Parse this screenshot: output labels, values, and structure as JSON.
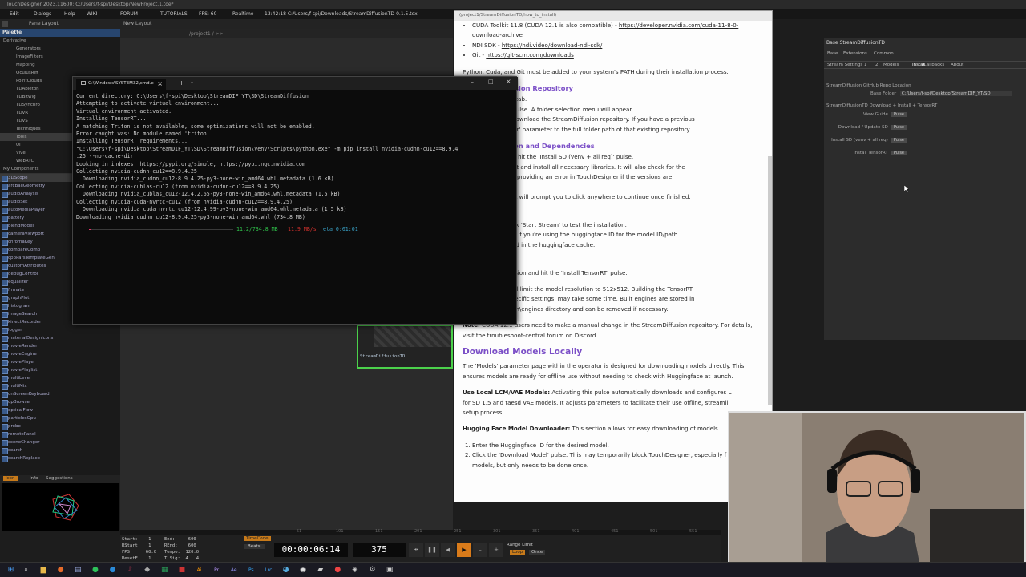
{
  "titlebar": "TouchDesigner 2023.11600: C:/Users/f-spi/Desktop/NewProject.1.toe*",
  "menu": [
    "Edit",
    "Dialogs",
    "Help",
    "WIKI",
    "FORUM",
    "TUTORIALS",
    "FPS: 60",
    "Realtime",
    "13:42:18 C:/Users/f-spi/Downloads/StreamDiffusionTD-0.1.5.tox"
  ],
  "toolbar": {
    "pane_layout": "Pane Layout",
    "new_layout": "New Layout",
    "path": "/project1 / >>"
  },
  "palette": {
    "title": "Palette",
    "tree": [
      "Derivative",
      "Generators",
      "ImageFilters",
      "Mapping",
      "OculusRift",
      "PointClouds",
      "TDAbleton",
      "TDBitwig",
      "TDSynchro",
      "TDVR",
      "TDVS",
      "Techniques",
      "Tools",
      "UI",
      "Vive",
      "WebRTC",
      "My Components"
    ],
    "components": [
      "3DScope",
      "arcBallGeometry",
      "audioAnalysis",
      "audioSet",
      "autoMediaPlayer",
      "battery",
      "blendModes",
      "cameraViewport",
      "chromaKey",
      "compareComp",
      "cppParsTemplateGen",
      "customAttributes",
      "debugControl",
      "equalizer",
      "firmata",
      "graphPlot",
      "histogram",
      "imageSearch",
      "kinectRecorder",
      "logger",
      "materialDesignIcons",
      "movieRender",
      "movieEngine",
      "moviePlayer",
      "moviePlaylist",
      "multiLevel",
      "multiMix",
      "onScreenKeyboard",
      "opBrowser",
      "opticalFlow",
      "particlesGpu",
      "probe",
      "remotePanel",
      "sceneChanger",
      "search",
      "searchReplace"
    ],
    "preview_tabs": [
      "Icon",
      "Info",
      "Suggestions"
    ]
  },
  "network": {
    "node_label": "StreamDiffusionTD"
  },
  "terminal": {
    "tab_title": "C:\\Windows\\SYSTEM32\\cmd.e",
    "lines": [
      "Current directory: C:\\Users\\f-spi\\Desktop\\StreamDIF_YT\\SD\\StreamDiffusion",
      "Attempting to activate virtual environment...",
      "Virtual environment activated.",
      "Installing TensorRT...",
      "A matching Triton is not available, some optimizations will not be enabled.",
      "Error caught was: No module named 'triton'",
      "Installing TensorRT requirements...",
      "\"C:\\Users\\f-spi\\Desktop\\StreamDIF_YT\\SD\\StreamDiffusion\\venv\\Scripts\\python.exe\" -m pip install nvidia-cudnn-cu12==8.9.4",
      ".25 --no-cache-dir",
      "Looking in indexes: https://pypi.org/simple, https://pypi.ngc.nvidia.com",
      "Collecting nvidia-cudnn-cu12==8.9.4.25",
      "  Downloading nvidia_cudnn_cu12-8.9.4.25-py3-none-win_amd64.whl.metadata (1.6 kB)",
      "Collecting nvidia-cublas-cu12 (from nvidia-cudnn-cu12==8.9.4.25)",
      "  Downloading nvidia_cublas_cu12-12.4.2.65-py3-none-win_amd64.whl.metadata (1.5 kB)",
      "Collecting nvidia-cuda-nvrtc-cu12 (from nvidia-cudnn-cu12==8.9.4.25)",
      "  Downloading nvidia_cuda_nvrtc_cu12-12.4.99-py3-none-win_amd64.whl.metadata (1.5 kB)",
      "Downloading nvidia_cudnn_cu12-8.9.4.25-py3-none-win_amd64.whl (734.8 MB)"
    ],
    "progress": {
      "fraction": 0.015,
      "size": "11.2/734.8 MB",
      "speed": "11.9 MB/s",
      "eta": "eta 0:01:01"
    }
  },
  "doc": {
    "tab": "(project1/StreamDiffusionTD/how_to_install)",
    "items": [
      {
        "t": "li",
        "text": "CUDA Toolkit 11.8 (CUDA 12.1 is also compatible) - ",
        "link": "https://developer.nvidia.com/cuda-11-8-0-download-archive"
      },
      {
        "t": "li",
        "text": "NDI SDK - ",
        "link": "https://ndi.video/download-ndi-sdk/"
      },
      {
        "t": "li",
        "text": "Git - ",
        "link": "https://git-scm.com/downloads"
      },
      {
        "t": "p",
        "text": "Python, Cuda, and Git must be added to your system's PATH during their installation process."
      },
      {
        "t": "h3",
        "text": "d StreamDiffusion Repository"
      },
      {
        "t": "p",
        "text": ", go to the 'Install' tab.\noad / Update SD' pulse. A folder selection menu will appear.\nn on your disk to download the StreamDiffusion repository. If you have a previous\nset the 'Base Folder' parameter to the full folder path of that existing repository."
      },
      {
        "t": "h3",
        "text": "StreamDiffusion and Dependencies"
      },
      {
        "t": "p",
        "text": "ng or updating SD, hit the 'Install SD (venv + all req)' pulse.\nvirtual environment and install all necessary libraries. It will also check for the\nnd CUDA versions, providing an error in TouchDesigner if the versions are\n\ness to complete—it will prompt you to click anywhere to continue once finished."
      },
      {
        "t": "h3",
        "text": "tallation"
      },
      {
        "t": "p",
        "text": "gs 1' page and click 'Start Stream' to test the installation.\nad a model for you if you're using the huggingface ID for the model ID/path\ne models are stored in the huggingface cache."
      },
      {
        "t": "h3",
        "text": "(optional)"
      },
      {
        "t": "p",
        "text": "tab in StreamDiffusion and hit the 'Install TensorRT' pulse."
      },
      {
        "t": "p",
        "text": "n boost FPS but will limit the model resolution to 512x512. Building the TensorRT\nirst launch with specific settings, may take some time. Built engines are stored in\nthe StreamDiffusion\\engines directory and can be removed if necessary."
      },
      {
        "t": "p",
        "bold": "Note:",
        "text": " CUDA 12.1 users need to make a manual change in the StreamDiffusion repository. For details,\nvisit the troubleshoot-central forum on Discord."
      },
      {
        "t": "h2",
        "text": "Download Models Locally"
      },
      {
        "t": "p",
        "text": "The 'Models' parameter page within the operator is designed for downloading models directly. This\nensures models are ready for offline use without needing to check with Huggingface at launch."
      },
      {
        "t": "p",
        "bold": "Use Local LCM/VAE Models:",
        "text": " Activating this pulse automatically downloads and configures L\nfor SD 1.5 and taesd VAE models. It adjusts parameters to facilitate their use offline, streamli\nsetup process."
      },
      {
        "t": "p",
        "bold": "Hugging Face Model Downloader:",
        "text": " This section allows for easy downloading of models."
      },
      {
        "t": "ol",
        "items": [
          "Enter the Huggingface ID for the desired model.",
          "Click the 'Download Model' pulse. This may temporarily block TouchDesigner, especially f\nmodels, but only needs to be done once."
        ]
      }
    ]
  },
  "params": {
    "header": "Base  StreamDiffusionTD",
    "tabs_row1": [
      "Base",
      "Extensions",
      "Common"
    ],
    "tabs_row2": [
      "Stream Settings 1",
      "2",
      "Models",
      "Install",
      "Callbacks",
      "About"
    ],
    "section1": "StreamDiffusion GitHub Repo Location",
    "base_folder_label": "Base Folder",
    "base_folder_value": "C:/Users/f-spi/Desktop/StreamDIF_YT/SD",
    "section2": "StreamDiffusionTD Download + Install + TensorRT",
    "rows": [
      {
        "label": "View Guide",
        "btn": "Pulse"
      },
      {
        "label": "Download / Update SD",
        "btn": "Pulse"
      },
      {
        "label": "Install SD (venv + all req)",
        "btn": "Pulse"
      },
      {
        "label": "Install TensorRT",
        "btn": "Pulse"
      }
    ]
  },
  "timeline": {
    "stats": "Start:    1     End:     600\nRStart:   1     REnd:    600\nFPS:     60.0   Tempo:  120.0\nResetF:   1     T Sig:  4   4",
    "timecode_label": "TimeCode",
    "beats_label": "Beats",
    "timecode": "00:00:06:14",
    "frame": "375",
    "range_limit": "Range Limit",
    "loop": "Loop",
    "once": "Once",
    "ruler": [
      "51",
      "101",
      "151",
      "201",
      "251",
      "301",
      "351",
      "401",
      "451",
      "501",
      "551"
    ]
  },
  "colors": {
    "accent": "#7b4fc7",
    "node_border": "#4bd14b",
    "progress_bar": "#e8346f"
  }
}
